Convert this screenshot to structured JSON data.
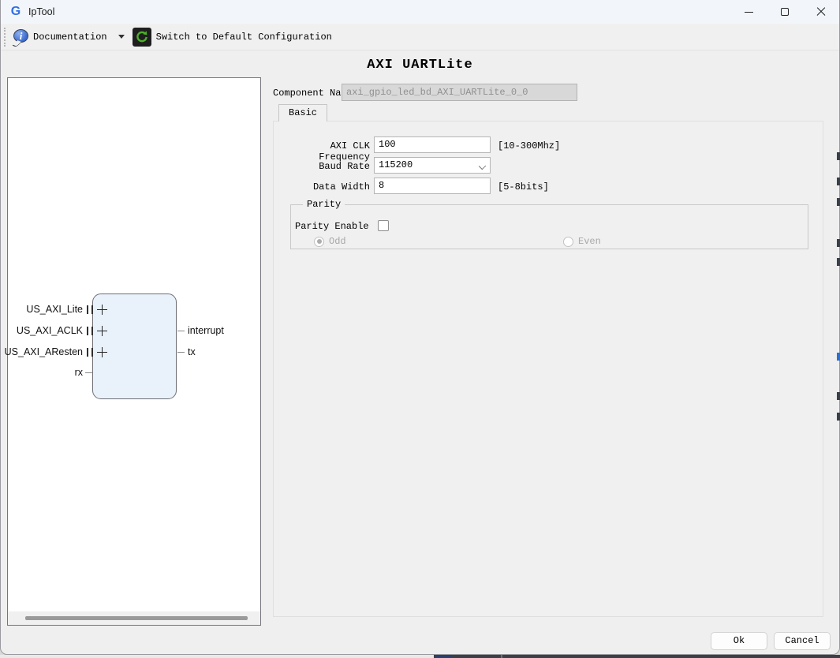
{
  "window": {
    "logo_letter": "G",
    "title": "IpTool"
  },
  "toolbar": {
    "documentation_label": "Documentation",
    "switch_label": "Switch to Default Configuration"
  },
  "page": {
    "title": "AXI UARTLite"
  },
  "component_name": {
    "label": "Component Name",
    "value": "axi_gpio_led_bd_AXI_UARTLite_0_0",
    "disabled": true
  },
  "tabs": [
    {
      "label": "Basic",
      "active": true
    }
  ],
  "form": {
    "axi_clk": {
      "label": "AXI CLK Frequency",
      "value": "100",
      "hint": "[10-300Mhz]"
    },
    "baud_rate": {
      "label": "Baud Rate",
      "value": "115200"
    },
    "data_width": {
      "label": "Data Width",
      "value": "8",
      "hint": "[5-8bits]"
    },
    "parity": {
      "legend": "Parity",
      "enable_label": "Parity Enable",
      "enable_checked": false,
      "options": [
        {
          "label": "Odd",
          "selected": true,
          "disabled": true
        },
        {
          "label": "Even",
          "selected": false,
          "disabled": true
        }
      ]
    }
  },
  "diagram": {
    "left_ports": [
      {
        "name": "US_AXI_Lite",
        "expandable": true
      },
      {
        "name": "US_AXI_ACLK",
        "expandable": true
      },
      {
        "name": "US_AXI_AResten",
        "expandable": true
      },
      {
        "name": "rx",
        "expandable": false
      }
    ],
    "right_ports": [
      {
        "name": "interrupt"
      },
      {
        "name": "tx"
      }
    ]
  },
  "footer": {
    "ok_label": "Ok",
    "cancel_label": "Cancel"
  },
  "colors": {
    "titlebar_bg": "#f2f5fa",
    "window_bg": "#efefef",
    "block_fill": "#e9f2fb",
    "logo_blue": "#2f6fe4",
    "refresh_green": "#4db02a",
    "info_blue": "#3a6ad0",
    "taskbar_dark": "#3a3f49",
    "taskbar_accent": "#27406e"
  }
}
